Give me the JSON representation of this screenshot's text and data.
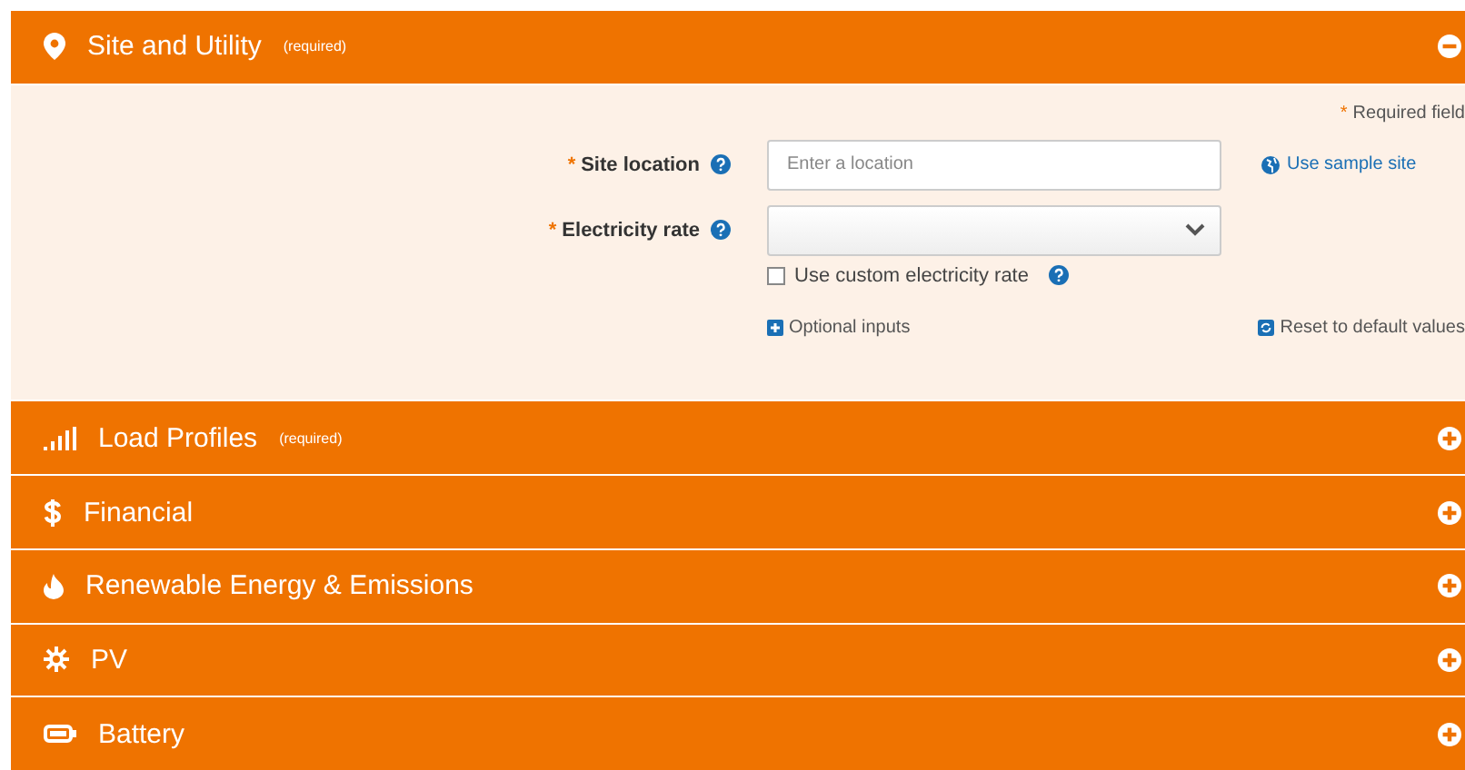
{
  "sections": [
    {
      "kind": "pin",
      "title": "Site and Utility",
      "note": "(required)",
      "expanded": true
    },
    {
      "kind": "signal",
      "title": "Load Profiles",
      "note": "(required)",
      "expanded": false
    },
    {
      "kind": "dollar",
      "title": "Financial",
      "expanded": false
    },
    {
      "kind": "drop",
      "title": "Renewable Energy & Emissions",
      "expanded": false
    },
    {
      "kind": "sun",
      "title": "PV",
      "expanded": false
    },
    {
      "kind": "battery",
      "title": "Battery",
      "expanded": false
    }
  ],
  "site_form": {
    "required_note": {
      "mark": "*",
      "text": "Required field"
    },
    "fields": [
      {
        "kind": "text",
        "required_mark": "*",
        "label": "Site location",
        "placeholder": "Enter a location",
        "link": "Use sample site"
      },
      {
        "kind": "select",
        "required_mark": "*",
        "label": "Electricity rate",
        "checkbox": {
          "label": "Use custom electricity rate",
          "checked": false
        }
      }
    ],
    "optional_inputs": "Optional inputs",
    "reset": "Reset to default values"
  }
}
